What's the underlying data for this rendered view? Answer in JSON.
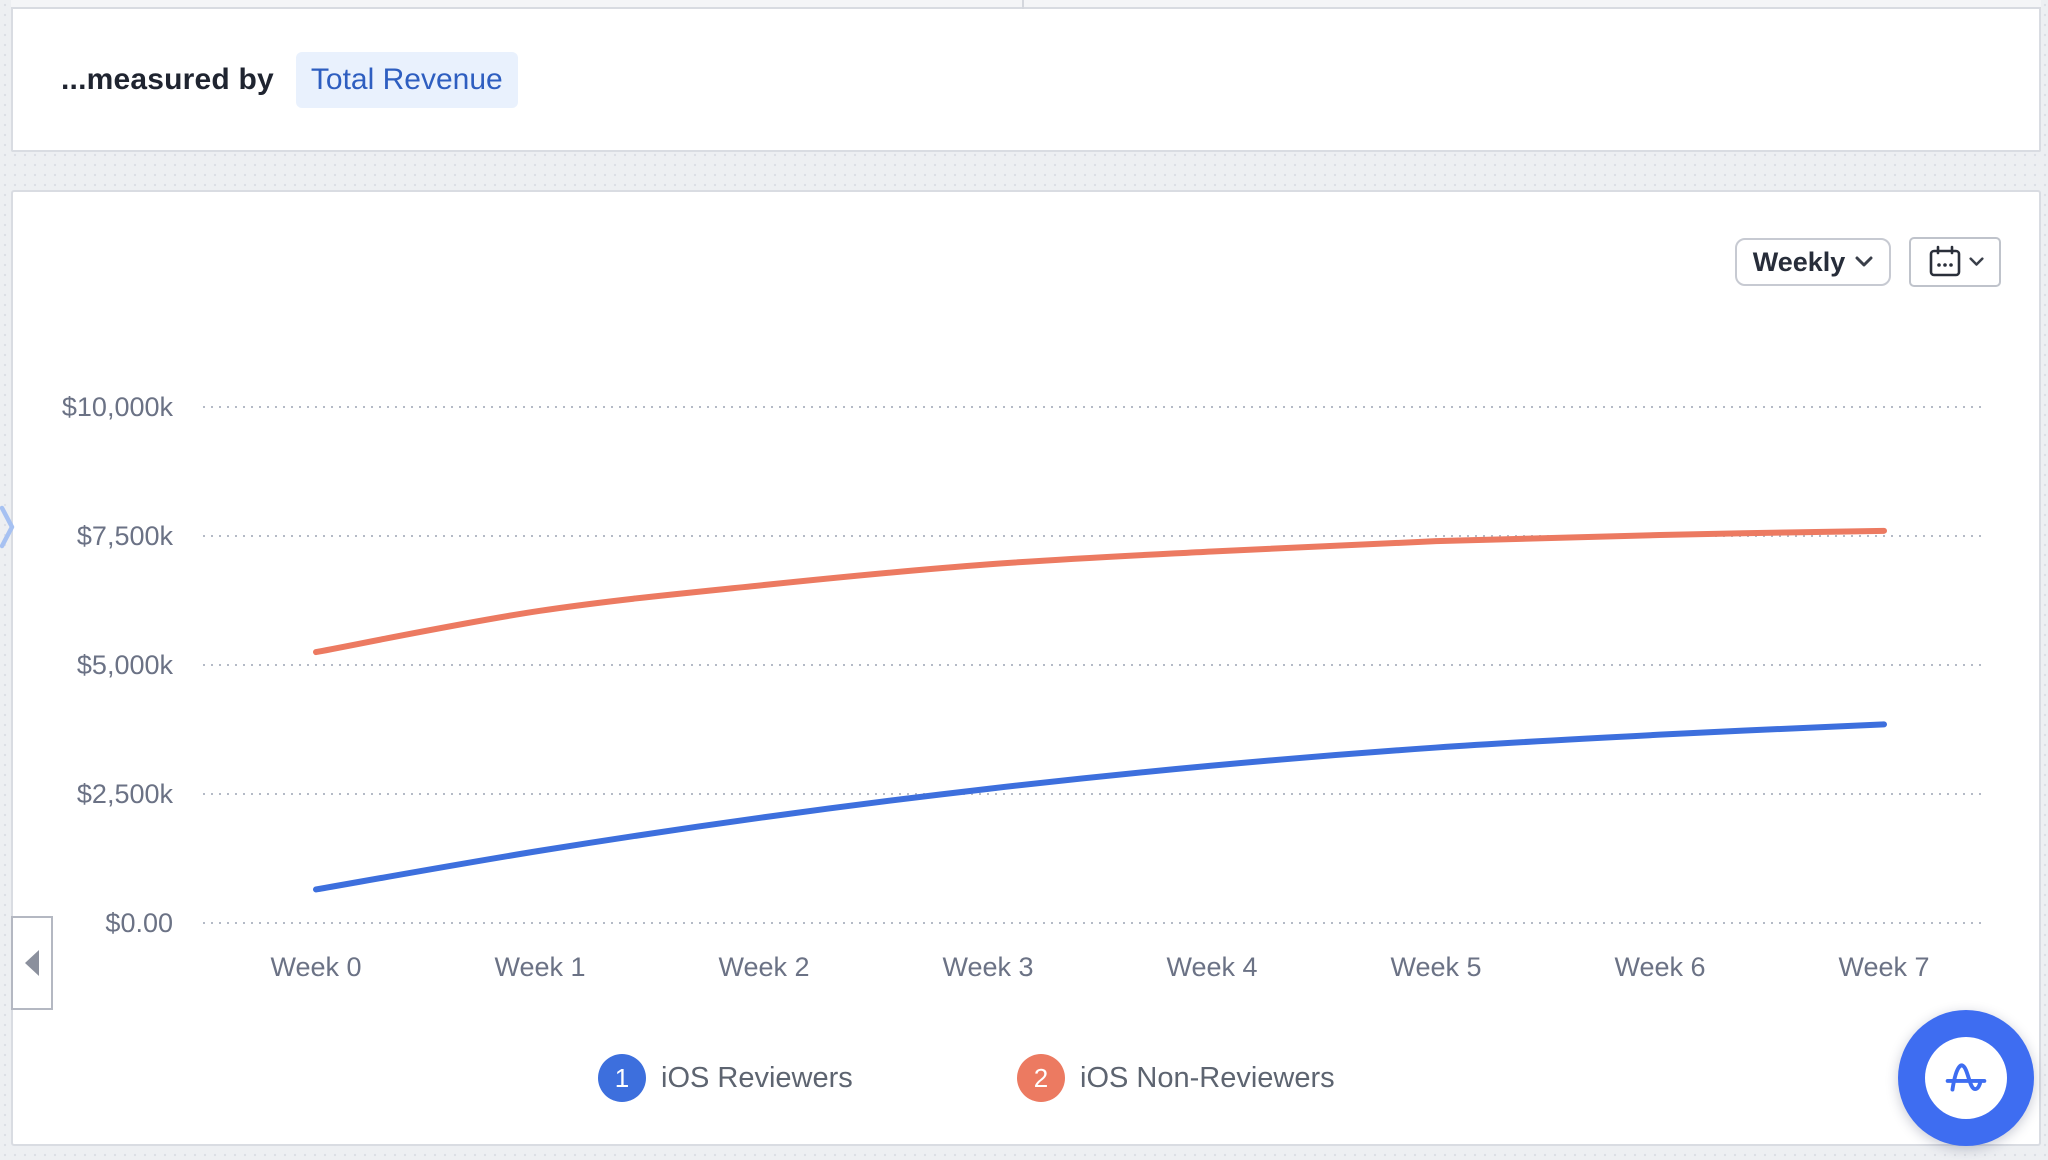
{
  "header": {
    "measured_by_label": "...measured by",
    "metric_chip_label": "Total Revenue"
  },
  "toolbar": {
    "granularity_label": "Weekly"
  },
  "chart_data": {
    "type": "line",
    "title": "",
    "xlabel": "",
    "ylabel": "",
    "unit": "thousands of USD",
    "categories": [
      "Week 0",
      "Week 1",
      "Week 2",
      "Week 3",
      "Week 4",
      "Week 5",
      "Week 6",
      "Week 7"
    ],
    "series": [
      {
        "name": "iOS Reviewers",
        "color": "#3d6fdd",
        "values": [
          650,
          1400,
          2050,
          2600,
          3050,
          3400,
          3650,
          3850
        ]
      },
      {
        "name": "iOS Non-Reviewers",
        "color": "#ec7a61",
        "values": [
          5250,
          6050,
          6550,
          6950,
          7200,
          7400,
          7520,
          7600
        ]
      }
    ],
    "ylim": [
      0,
      10000
    ],
    "yticks": [
      {
        "v": 0,
        "label": "$0.00"
      },
      {
        "v": 2500,
        "label": "$2,500k"
      },
      {
        "v": 5000,
        "label": "$5,000k"
      },
      {
        "v": 7500,
        "label": "$7,500k"
      },
      {
        "v": 10000,
        "label": "$10,000k"
      }
    ],
    "grid": "horizontal-dotted",
    "legend_position": "bottom"
  },
  "legend": {
    "items": [
      {
        "number": "1",
        "label": "iOS Reviewers",
        "color": "#3d6fdd"
      },
      {
        "number": "2",
        "label": "iOS Non-Reviewers",
        "color": "#ec7a61"
      }
    ]
  },
  "icons": {
    "granularity_chevron": "chevron-down",
    "calendar": "calendar",
    "calendar_chevron": "chevron-down",
    "collapse": "triangle-left",
    "expand": "chevron-right",
    "logo": "amplitude-wave-a"
  },
  "colors": {
    "accent_blue": "#3d6fdd",
    "accent_orange": "#ec7a61",
    "chip_bg": "#e9f1fd",
    "chip_text": "#2e5ec0",
    "axis_text": "#6b7285",
    "gridline": "#b4bac6",
    "panel_border": "#d9dce2",
    "logo_blue": "#3e6df1"
  }
}
